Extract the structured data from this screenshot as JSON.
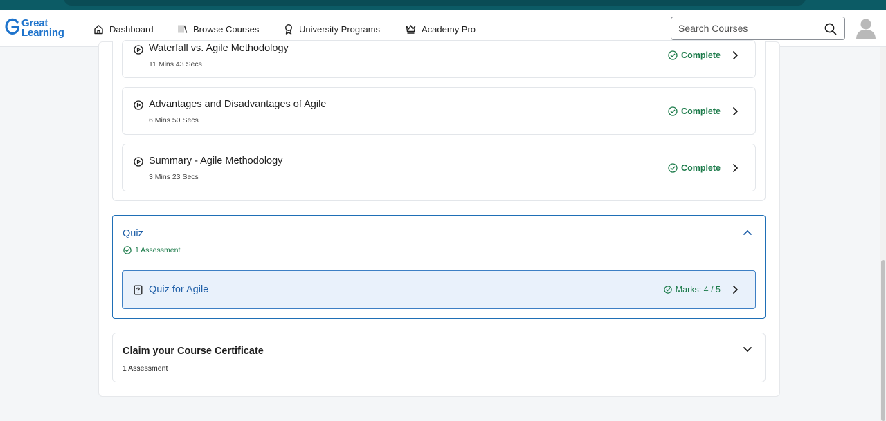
{
  "brand": {
    "logo_line1": "Great",
    "logo_line2": "Learning",
    "color": "#1f74cc"
  },
  "nav": [
    {
      "label": "Dashboard",
      "icon": "home-icon"
    },
    {
      "label": "Browse Courses",
      "icon": "library-icon"
    },
    {
      "label": "University Programs",
      "icon": "award-icon"
    },
    {
      "label": "Academy Pro",
      "icon": "crown-icon"
    }
  ],
  "search": {
    "placeholder": "Search Courses",
    "value": ""
  },
  "lessons": [
    {
      "title": "Waterfall vs. Agile Methodology",
      "duration": "11 Mins 43 Secs",
      "status": "Complete"
    },
    {
      "title": "Advantages and Disadvantages of Agile",
      "duration": "6 Mins 50 Secs",
      "status": "Complete"
    },
    {
      "title": "Summary - Agile Methodology",
      "duration": "3 Mins 23 Secs",
      "status": "Complete"
    }
  ],
  "quiz": {
    "title": "Quiz",
    "subtitle": "1 Assessment",
    "item_title": "Quiz for Agile",
    "marks": "Marks: 4 / 5"
  },
  "claim": {
    "title": "Claim your Course Certificate",
    "subtitle": "1 Assessment"
  },
  "colors": {
    "accent": "#1f5fa8",
    "success": "#1c7b4a",
    "header_strip": "#0c5b65"
  }
}
